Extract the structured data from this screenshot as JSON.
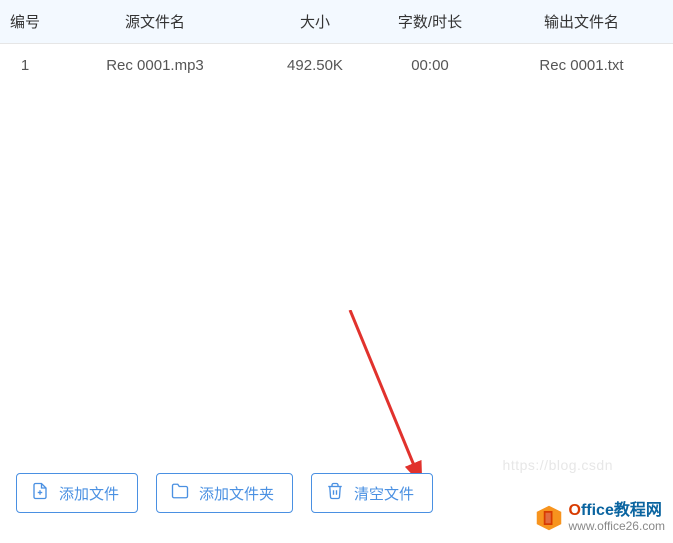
{
  "table": {
    "headers": {
      "num": "编号",
      "source": "源文件名",
      "size": "大小",
      "duration": "字数/时长",
      "output": "输出文件名"
    },
    "rows": [
      {
        "num": "1",
        "source": "Rec 0001.mp3",
        "size": "492.50K",
        "duration": "00:00",
        "output": "Rec 0001.txt"
      }
    ]
  },
  "toolbar": {
    "add_file": "添加文件",
    "add_folder": "添加文件夹",
    "clear_files": "清空文件"
  },
  "watermark": {
    "title_o": "O",
    "title_rest": "ffice教程网",
    "url": "www.office26.com"
  },
  "bg_text": "https://blog.csdn"
}
